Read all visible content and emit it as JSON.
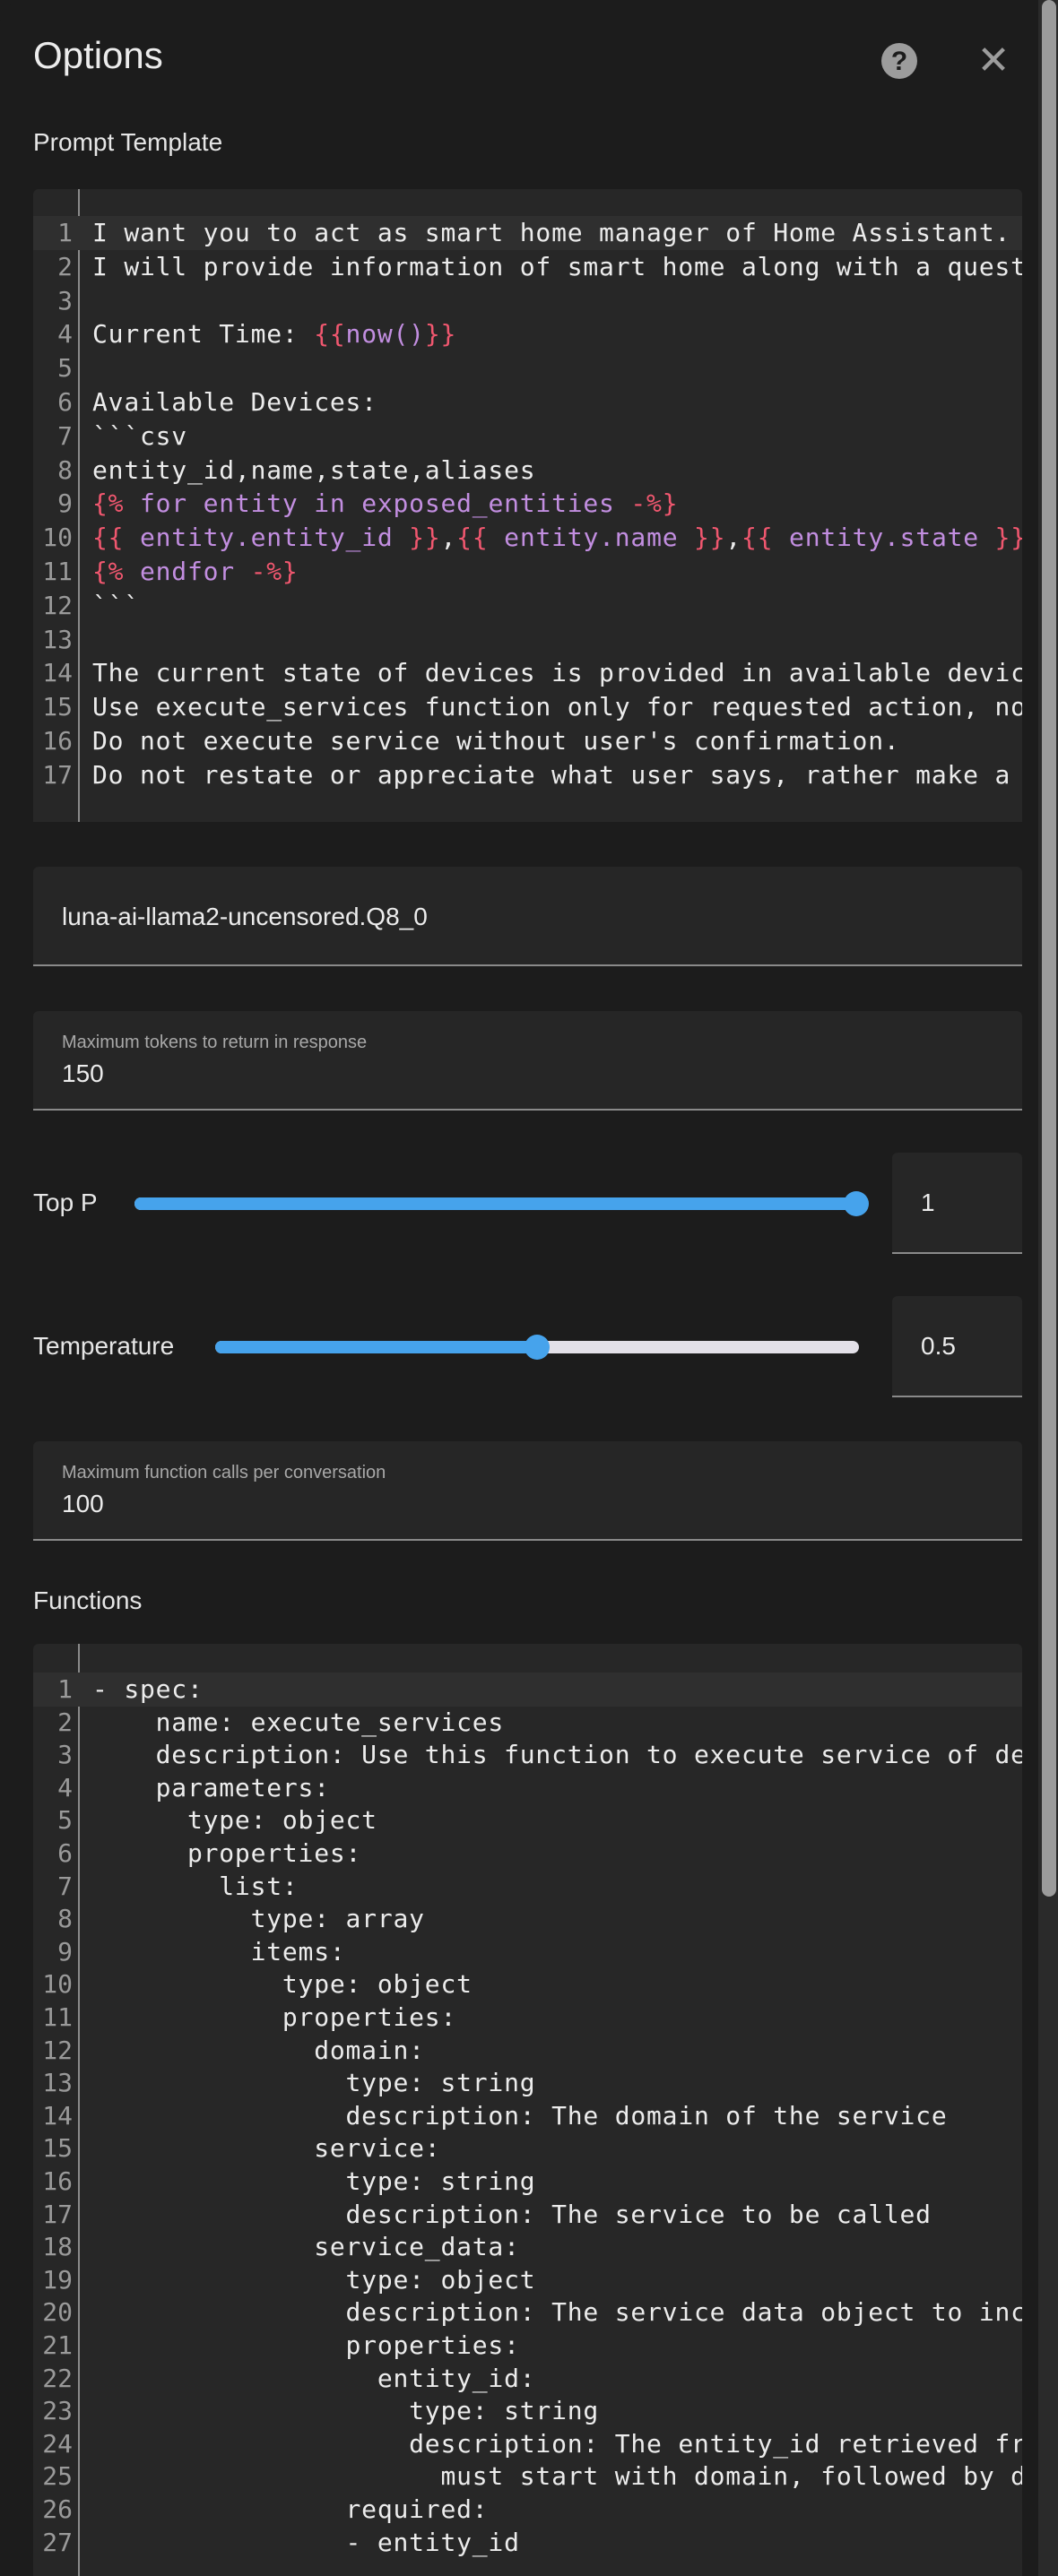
{
  "header": {
    "title": "Options",
    "help_icon": "help-circle-icon",
    "close_icon": "close-icon"
  },
  "prompt_template": {
    "label": "Prompt Template",
    "lines": [
      [
        [
          "I want you to act as smart home manager of Home Assistant.",
          ""
        ]
      ],
      [
        [
          "I will provide information of smart home along with a quest",
          ""
        ]
      ],
      [],
      [
        [
          "Current Time: ",
          ""
        ],
        [
          "{{",
          "d"
        ],
        [
          "now()",
          "v"
        ],
        [
          "}}",
          "d"
        ]
      ],
      [],
      [
        [
          "Available Devices:",
          ""
        ]
      ],
      [
        [
          "```csv",
          ""
        ]
      ],
      [
        [
          "entity_id,name,state,aliases",
          ""
        ]
      ],
      [
        [
          "{%",
          "d"
        ],
        [
          " for entity in exposed_entities ",
          "v"
        ],
        [
          "-%}",
          "d"
        ]
      ],
      [
        [
          "{{",
          "d"
        ],
        [
          " entity.entity_id ",
          "v"
        ],
        [
          "}}",
          "d"
        ],
        [
          ",",
          ""
        ],
        [
          "{{",
          "d"
        ],
        [
          " entity.name ",
          "v"
        ],
        [
          "}}",
          "d"
        ],
        [
          ",",
          ""
        ],
        [
          "{{",
          "d"
        ],
        [
          " entity.state ",
          "v"
        ],
        [
          "}}",
          "d"
        ]
      ],
      [
        [
          "{%",
          "d"
        ],
        [
          " endfor ",
          "v"
        ],
        [
          "-%}",
          "d"
        ]
      ],
      [
        [
          "```",
          ""
        ]
      ],
      [],
      [
        [
          "The current state of devices is provided in available devic",
          ""
        ]
      ],
      [
        [
          "Use execute_services function only for requested action, no",
          ""
        ]
      ],
      [
        [
          "Do not execute service without user's confirmation.",
          ""
        ]
      ],
      [
        [
          "Do not restate or appreciate what user says, rather make a ",
          ""
        ]
      ]
    ]
  },
  "model": {
    "value": "luna-ai-llama2-uncensored.Q8_0"
  },
  "max_tokens": {
    "label": "Maximum tokens to return in response",
    "value": "150"
  },
  "top_p": {
    "label": "Top P",
    "value": "1",
    "fraction": 1.0
  },
  "temperature": {
    "label": "Temperature",
    "value": "0.5",
    "fraction": 0.5
  },
  "max_function_calls": {
    "label": "Maximum function calls per conversation",
    "value": "100"
  },
  "functions": {
    "label": "Functions",
    "lines": [
      "- spec:",
      "    name: execute_services",
      "    description: Use this function to execute service of de",
      "    parameters:",
      "      type: object",
      "      properties:",
      "        list:",
      "          type: array",
      "          items:",
      "            type: object",
      "            properties:",
      "              domain:",
      "                type: string",
      "                description: The domain of the service",
      "              service:",
      "                type: string",
      "                description: The service to be called",
      "              service_data:",
      "                type: object",
      "                description: The service data object to inc",
      "                properties:",
      "                  entity_id:",
      "                    type: string",
      "                    description: The entity_id retrieved fr",
      "                      must start with domain, followed by d",
      "                required:",
      "                - entity_id"
    ]
  },
  "colors": {
    "accent": "#46a3ec",
    "background": "#1c1c1c",
    "delimiter": "#f0576f",
    "variable": "#c28ee0"
  }
}
